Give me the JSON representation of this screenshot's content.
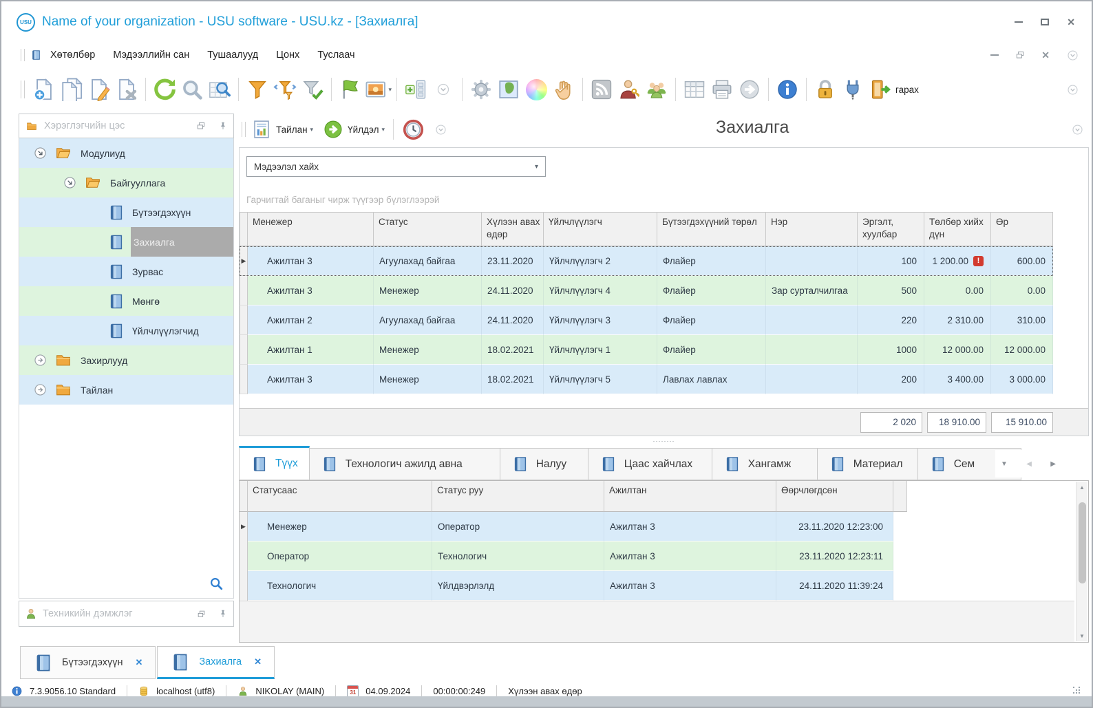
{
  "glyphs": {
    "close": "✕",
    "caret": "▾",
    "dots": "········",
    "row_arrow": "▶",
    "warning": "!",
    "nav_down": "▼",
    "nav_left": "◀",
    "nav_right": "▶",
    "scroll_up": "▲",
    "scroll_down": "▼"
  },
  "colors": {
    "accent": "#1e9cd8",
    "row_blue": "#d9ebf9",
    "row_green": "#def4de",
    "selected_gray": "#ababab",
    "warning_red": "#d23b2f"
  },
  "window": {
    "logo_text": "USU",
    "title": "Name of your organization - USU software - USU.kz - [Захиалга]"
  },
  "menu": {
    "items": [
      {
        "label": "Хөтөлбөр"
      },
      {
        "label": "Мэдээллийн сан"
      },
      {
        "label": "Тушаалууд"
      },
      {
        "label": "Цонх"
      },
      {
        "label": "Туслаач"
      }
    ]
  },
  "toolbar": {
    "exit_label": "гарах",
    "icons": [
      "new-record",
      "copy-record",
      "edit-record",
      "delete-record",
      "refresh",
      "search",
      "search-in-table",
      "filter",
      "filter-columns",
      "filter-apply",
      "flag",
      "image",
      "layout-panels",
      "collapse",
      "settings-gear",
      "map",
      "color-wheel",
      "drag-hand",
      "rss-feed",
      "user-permissions",
      "users",
      "table",
      "printer",
      "go-forward",
      "info",
      "lock",
      "plugin",
      "exit"
    ]
  },
  "sidebar": {
    "header": "Хэрэглэгчийн цэс",
    "support_header": "Техникийн дэмжлэг",
    "tree": [
      {
        "label": "Модулиуд",
        "type": "folder-open",
        "level": 0,
        "expanded": true
      },
      {
        "label": "Байгууллага",
        "type": "folder-open",
        "level": 1,
        "expanded": true
      },
      {
        "label": "Бүтээгдэхүүн",
        "type": "module",
        "level": 2
      },
      {
        "label": "Захиалга",
        "type": "module",
        "level": 2,
        "selected": true
      },
      {
        "label": "Зурвас",
        "type": "module",
        "level": 2
      },
      {
        "label": "Мөнгө",
        "type": "module",
        "level": 2
      },
      {
        "label": "Үйлчлүүлэгчид",
        "type": "module",
        "level": 2
      },
      {
        "label": "Захирлууд",
        "type": "folder-closed",
        "level": 0,
        "expanded": false
      },
      {
        "label": "Тайлан",
        "type": "folder-closed",
        "level": 0,
        "expanded": false
      }
    ]
  },
  "main": {
    "report_label": "Тайлан",
    "action_label": "Үйлдэл",
    "page_title": "Захиалга",
    "search_value": "Мэдээлэл хайх",
    "group_hint": "Гарчигтай баганыг чирж түүгээр бүлэглээрэй",
    "grid": {
      "columns": [
        "Менежер",
        "Статус",
        "Хүлээн авах өдөр",
        "Үйлчлүүлэгч",
        "Бүтээгдэхүүний төрөл",
        "Нэр",
        "Эргэлт, хуулбар",
        "Төлбөр хийх дүн",
        "Өр"
      ],
      "rows": [
        [
          "Ажилтан 3",
          "Агуулахад байгаа",
          "23.11.2020",
          "Үйлчлүүлэгч 2",
          "Флайер",
          "",
          "100",
          "1 200.00",
          "600.00"
        ],
        [
          "Ажилтан 3",
          "Менежер",
          "24.11.2020",
          "Үйлчлүүлэгч 4",
          "Флайер",
          "Зар сурталчилгаа",
          "500",
          "0.00",
          "0.00"
        ],
        [
          "Ажилтан 2",
          "Агуулахад байгаа",
          "24.11.2020",
          "Үйлчлүүлэгч 3",
          "Флайер",
          "",
          "220",
          "2 310.00",
          "310.00"
        ],
        [
          "Ажилтан 1",
          "Менежер",
          "18.02.2021",
          "Үйлчлүүлэгч 1",
          "Флайер",
          "",
          "1000",
          "12 000.00",
          "12 000.00"
        ],
        [
          "Ажилтан 3",
          "Менежер",
          "18.02.2021",
          "Үйлчлүүлэгч 5",
          "Лавлах лавлах",
          "",
          "200",
          "3 400.00",
          "3 000.00"
        ]
      ],
      "summary": {
        "turnover": "2 020",
        "payment": "18 910.00",
        "debt": "15 910.00"
      }
    },
    "tabs": [
      {
        "label": "Түүх",
        "active": true
      },
      {
        "label": "Технологич ажилд авна"
      },
      {
        "label": "Налуу"
      },
      {
        "label": "Цаас хайчлах"
      },
      {
        "label": "Хангамж"
      },
      {
        "label": "Материал"
      },
      {
        "label": "Сем"
      }
    ],
    "history": {
      "columns": [
        "Статусаас",
        "Статус руу",
        "Ажилтан",
        "Өөрчлөгдсөн"
      ],
      "rows": [
        [
          "Менежер",
          "Оператор",
          "Ажилтан 3",
          "23.11.2020 12:23:00"
        ],
        [
          "Оператор",
          "Технологич",
          "Ажилтан 3",
          "23.11.2020 12:23:11"
        ],
        [
          "Технологич",
          "Үйлдвэрлэлд",
          "Ажилтан 3",
          "24.11.2020 11:39:24"
        ]
      ]
    }
  },
  "doc_tabs": [
    {
      "label": "Бүтээгдэхүүн"
    },
    {
      "label": "Захиалга",
      "active": true
    }
  ],
  "statusbar": {
    "version": "7.3.9056.10 Standard",
    "database": "localhost (utf8)",
    "user": "NIKOLAY (MAIN)",
    "cal_glyph": "31",
    "date": "04.09.2024",
    "timer": "00:00:00:249",
    "field": "Хүлээн авах өдөр"
  }
}
